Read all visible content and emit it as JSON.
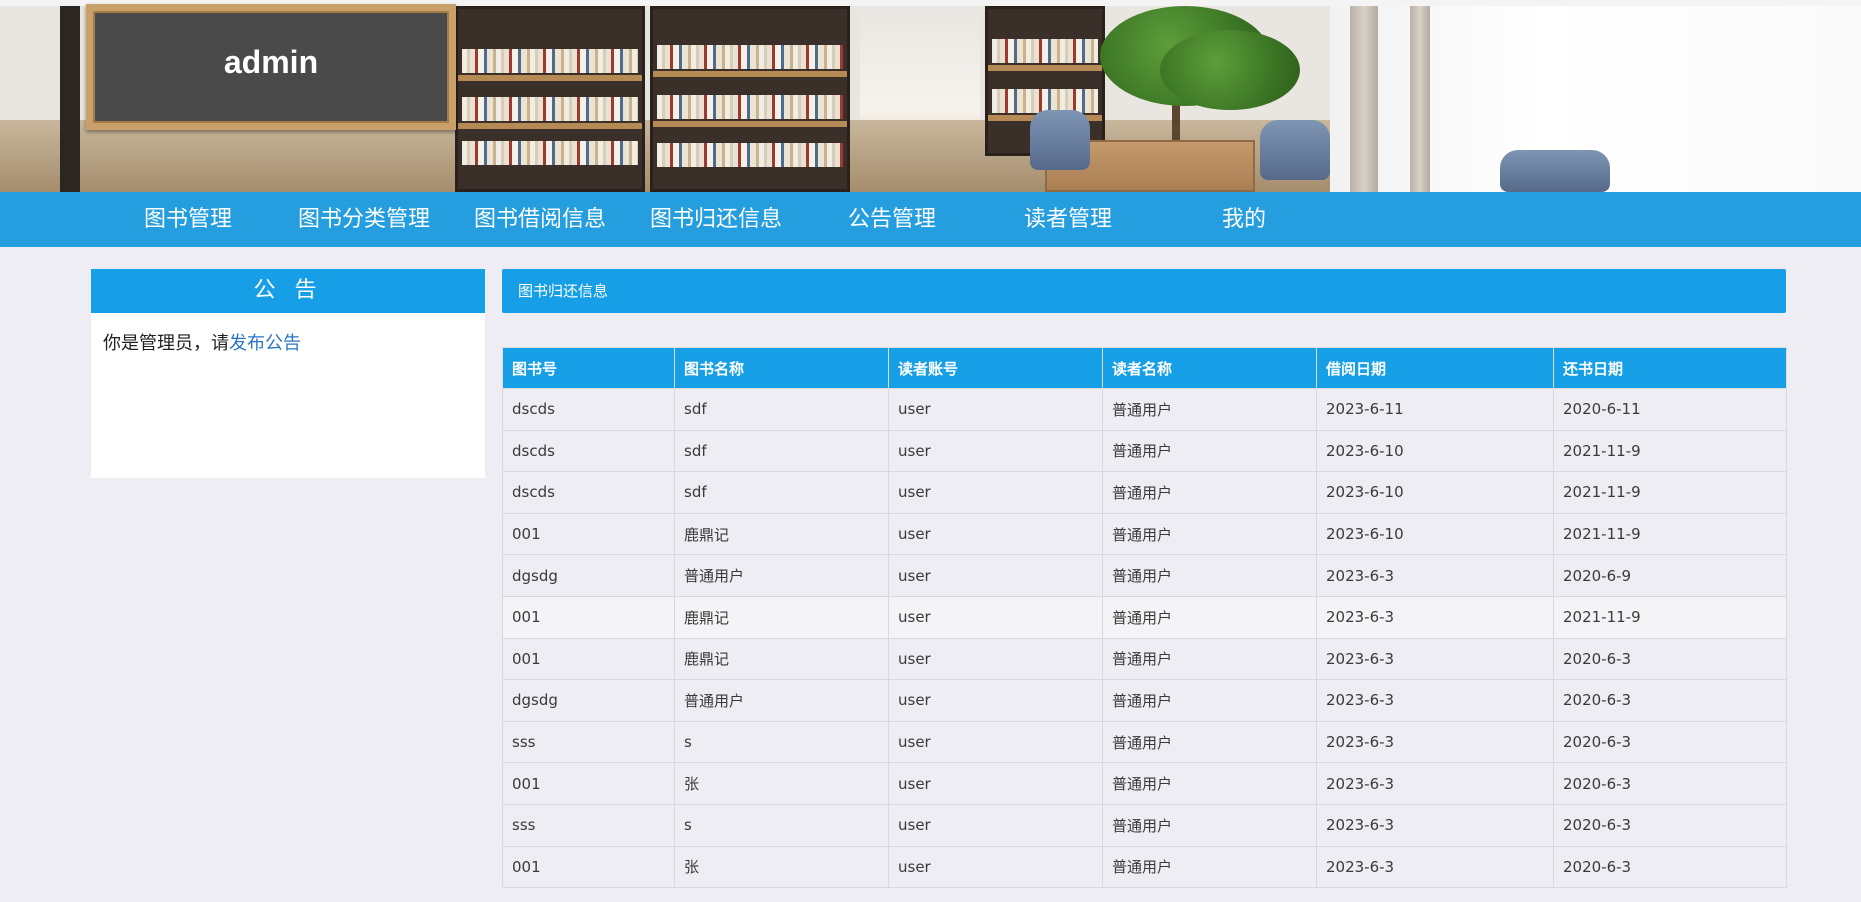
{
  "header": {
    "title": "admin"
  },
  "nav": {
    "items": [
      {
        "label": "图书管理"
      },
      {
        "label": "图书分类管理"
      },
      {
        "label": "图书借阅信息"
      },
      {
        "label": "图书归还信息"
      },
      {
        "label": "公告管理"
      },
      {
        "label": "读者管理"
      },
      {
        "label": "我的"
      }
    ]
  },
  "announcement": {
    "title": "公 告",
    "text": "你是管理员，请",
    "link": "发布公告"
  },
  "panel": {
    "title": "图书归还信息"
  },
  "table": {
    "columns": [
      "图书号",
      "图书名称",
      "读者账号",
      "读者名称",
      "借阅日期",
      "还书日期"
    ],
    "rows": [
      [
        "dscds",
        "sdf",
        "user",
        "普通用户",
        "2023-6-11",
        "2020-6-11"
      ],
      [
        "dscds",
        "sdf",
        "user",
        "普通用户",
        "2023-6-10",
        "2021-11-9"
      ],
      [
        "dscds",
        "sdf",
        "user",
        "普通用户",
        "2023-6-10",
        "2021-11-9"
      ],
      [
        "001",
        "鹿鼎记",
        "user",
        "普通用户",
        "2023-6-10",
        "2021-11-9"
      ],
      [
        "dgsdg",
        "普通用户",
        "user",
        "普通用户",
        "2023-6-3",
        "2020-6-9"
      ],
      [
        "001",
        "鹿鼎记",
        "user",
        "普通用户",
        "2023-6-3",
        "2021-11-9"
      ],
      [
        "001",
        "鹿鼎记",
        "user",
        "普通用户",
        "2023-6-3",
        "2020-6-3"
      ],
      [
        "dgsdg",
        "普通用户",
        "user",
        "普通用户",
        "2023-6-3",
        "2020-6-3"
      ],
      [
        "sss",
        "s",
        "user",
        "普通用户",
        "2023-6-3",
        "2020-6-3"
      ],
      [
        "001",
        "张",
        "user",
        "普通用户",
        "2023-6-3",
        "2020-6-3"
      ],
      [
        "sss",
        "s",
        "user",
        "普通用户",
        "2023-6-3",
        "2020-6-3"
      ],
      [
        "001",
        "张",
        "user",
        "普通用户",
        "2023-6-3",
        "2020-6-3"
      ]
    ]
  },
  "colors": {
    "accent": "#169fe6",
    "page_bg": "#ededf3",
    "link": "#2a76c4"
  }
}
